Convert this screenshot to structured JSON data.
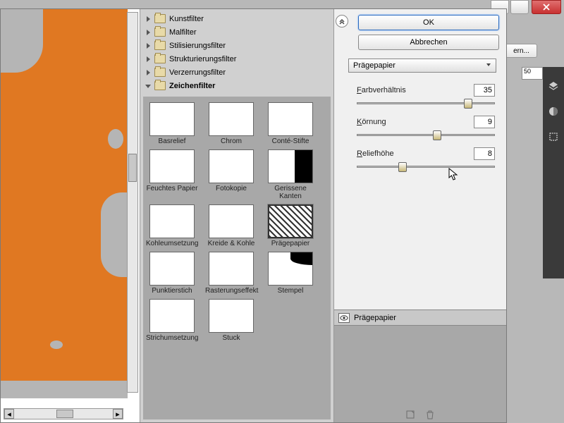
{
  "window": {
    "close_label": "X"
  },
  "ern_button": "ern...",
  "ruler_value": "50",
  "categories": [
    {
      "label": "Kunstfilter",
      "open": false
    },
    {
      "label": "Malfilter",
      "open": false
    },
    {
      "label": "Stilisierungsfilter",
      "open": false
    },
    {
      "label": "Strukturierungsfilter",
      "open": false
    },
    {
      "label": "Verzerrungsfilter",
      "open": false
    },
    {
      "label": "Zeichenfilter",
      "open": true
    }
  ],
  "thumbnails": [
    {
      "name": "Basrelief",
      "cls": "tb-bas"
    },
    {
      "name": "Chrom",
      "cls": "tb-chrom"
    },
    {
      "name": "Conté-Stifte",
      "cls": "tb-conte"
    },
    {
      "name": "Feuchtes Papier",
      "cls": "tb-feucht"
    },
    {
      "name": "Fotokopie",
      "cls": "tb-foto"
    },
    {
      "name": "Gerissene Kanten",
      "cls": "tb-geriss"
    },
    {
      "name": "Kohleumsetzung",
      "cls": "tb-kohle"
    },
    {
      "name": "Kreide & Kohle",
      "cls": "tb-kreide"
    },
    {
      "name": "Prägepapier",
      "cls": "tb-praege",
      "selected": true
    },
    {
      "name": "Punktierstich",
      "cls": "tb-punkt"
    },
    {
      "name": "Rasterungseffekt",
      "cls": "tb-raster"
    },
    {
      "name": "Stempel",
      "cls": "tb-stempel"
    },
    {
      "name": "Strichumsetzung",
      "cls": "tb-strich"
    },
    {
      "name": "Stuck",
      "cls": "tb-stuck"
    }
  ],
  "buttons": {
    "ok": "OK",
    "cancel": "Abbrechen"
  },
  "dropdown": {
    "selected": "Prägepapier"
  },
  "sliders": [
    {
      "label_u": "F",
      "label_rest": "arbverhältnis",
      "value": "35",
      "pos": 78
    },
    {
      "label_u": "K",
      "label_rest": "örnung",
      "value": "9",
      "pos": 55
    },
    {
      "label_u": "R",
      "label_rest": "eliefhöhe",
      "value": "8",
      "pos": 30
    }
  ],
  "layer": {
    "name": "Prägepapier"
  }
}
